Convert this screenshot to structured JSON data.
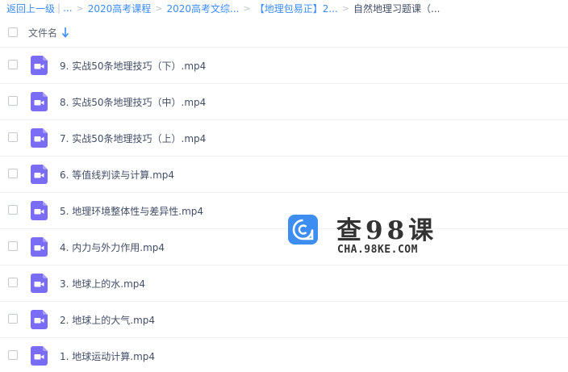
{
  "breadcrumb": {
    "back": "返回上一级",
    "divider": "|",
    "ellipsis": "...",
    "sep": ">",
    "crumbs": [
      "2020高考课程",
      "2020高考文综...",
      "【地理包易正】2...",
      "自然地理习题课（..."
    ]
  },
  "list_header": {
    "name_label": "文件名",
    "sort_icon": "arrow-down-icon"
  },
  "files": [
    {
      "name": "9. 实战50条地理技巧（下）.mp4"
    },
    {
      "name": "8. 实战50条地理技巧（中）.mp4"
    },
    {
      "name": "7. 实战50条地理技巧（上）.mp4"
    },
    {
      "name": "6. 等值线判读与计算.mp4"
    },
    {
      "name": "5. 地理环境整体性与差异性.mp4"
    },
    {
      "name": "4. 内力与外力作用.mp4"
    },
    {
      "name": "3. 地球上的水.mp4"
    },
    {
      "name": "2. 地球上的大气.mp4"
    },
    {
      "name": "1. 地球运动计算.mp4"
    }
  ],
  "watermark": {
    "title": "查98课",
    "subtitle": "CHA.98KE.COM"
  },
  "colors": {
    "link": "#3b8cff",
    "video_icon": "#7b6cf6",
    "logo": "#3d8ef0"
  }
}
